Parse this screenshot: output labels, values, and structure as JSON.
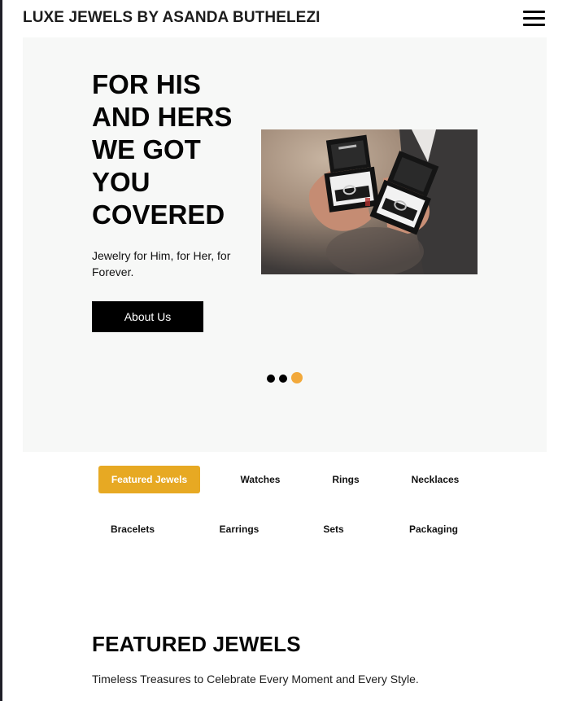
{
  "header": {
    "brand": "LUXE JEWELS BY ASANDA BUTHELEZI",
    "menu_icon": "hamburger-menu-icon"
  },
  "hero": {
    "title": "FOR HIS\nAND HERS\nWE GOT\nYOU\nCOVERED",
    "subtitle": "Jewelry for Him, for Her, for Forever.",
    "button_label": "About Us",
    "image_description": "hands holding two open black ring boxes",
    "carousel": {
      "total_slides": 3,
      "active_slide": 3,
      "colors": {
        "inactive": "#000000",
        "active": "#f2a93b"
      }
    }
  },
  "categories": {
    "tabs": [
      {
        "label": "Featured Jewels",
        "active": true
      },
      {
        "label": "Watches",
        "active": false
      },
      {
        "label": "Rings",
        "active": false
      },
      {
        "label": "Necklaces",
        "active": false
      },
      {
        "label": "Bracelets",
        "active": false
      },
      {
        "label": "Earrings",
        "active": false
      },
      {
        "label": "Sets",
        "active": false
      },
      {
        "label": "Packaging",
        "active": false
      }
    ],
    "active_color": "#e7a923"
  },
  "featured": {
    "title": "FEATURED JEWELS",
    "subtitle": "Timeless Treasures to Celebrate Every Moment and Every Style."
  }
}
